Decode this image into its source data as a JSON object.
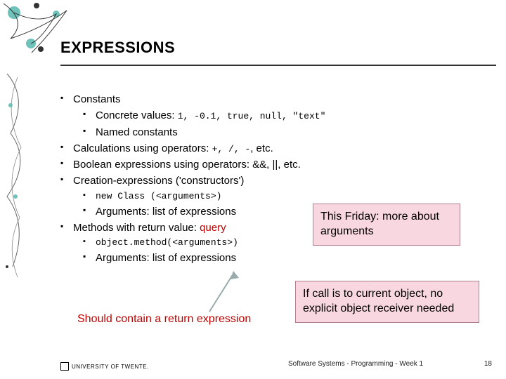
{
  "title": "EXPRESSIONS",
  "bullets": {
    "constants": "Constants",
    "concrete": "Concrete values: ",
    "concrete_code": "1, -0.1, true, null, \"text\"",
    "named": "Named constants",
    "calc_a": "Calculations using operators: ",
    "calc_code": "+, /, -",
    "calc_b": ", etc.",
    "bool": "Boolean expressions using operators: &&, ||, etc.",
    "create": "Creation-expressions ('constructors')",
    "create_code": "new Class (<arguments>)",
    "args1": "Arguments: list of expressions",
    "methods_a": "Methods with return value: ",
    "methods_b": "query",
    "obj_code": "object.method(<arguments>)",
    "args2": "Arguments: list of expressions"
  },
  "callout1": "This Friday: more about arguments",
  "callout2": "If call is to current object, no explicit object receiver needed",
  "return_note": "Should contain a return expression",
  "footer": {
    "logo_text": "UNIVERSITY OF TWENTE.",
    "mid": "Software Systems - Programming - Week 1",
    "page": "18"
  }
}
